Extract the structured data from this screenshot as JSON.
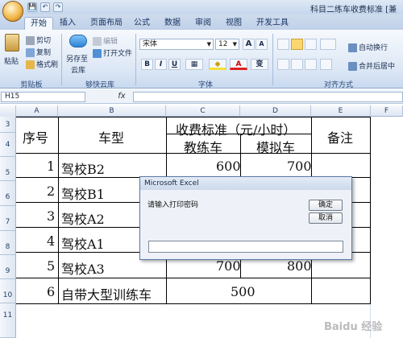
{
  "window": {
    "title": "科目二练车收费标准 [兼"
  },
  "quick_access": {
    "save": "💾",
    "undo": "↶",
    "redo": "↷"
  },
  "tabs": [
    "开始",
    "插入",
    "页面布局",
    "公式",
    "数据",
    "审阅",
    "视图",
    "开发工具"
  ],
  "ribbon": {
    "clipboard": {
      "paste": "粘贴",
      "cut": "剪切",
      "copy": "复制",
      "format_painter": "格式刷",
      "label": "剪贴板"
    },
    "cloud": {
      "save_to": "另存至",
      "save_to2": "云库",
      "edit": "编辑",
      "open": "打开文件",
      "label": "够快云库"
    },
    "font": {
      "name": "宋体",
      "size": "12",
      "grow": "A",
      "shrink": "A",
      "bold": "B",
      "italic": "I",
      "underline": "U",
      "border": "▦",
      "fill": "◆",
      "color": "A",
      "wen": "变",
      "label": "字体"
    },
    "align": {
      "wrap": "自动换行",
      "merge": "合并后居中",
      "label": "对齐方式"
    }
  },
  "formula_bar": {
    "cell": "H15",
    "fx": "fx",
    "value": ""
  },
  "columns": [
    "A",
    "B",
    "C",
    "D",
    "E",
    "F"
  ],
  "rows": [
    "3",
    "4",
    "5",
    "6",
    "7",
    "8",
    "9",
    "10",
    "11"
  ],
  "table": {
    "h_no": "序号",
    "h_type": "车型",
    "h_fee": "收费标准（元/小时）",
    "h_coach": "教练车",
    "h_sim": "模拟车",
    "h_note": "备注",
    "r1": {
      "no": "1",
      "type": "驾校B2",
      "coach": "600",
      "sim": "700"
    },
    "r2": {
      "no": "2",
      "type": "驾校B1"
    },
    "r3": {
      "no": "3",
      "type": "驾校A2"
    },
    "r4": {
      "no": "4",
      "type": "驾校A1"
    },
    "r5": {
      "no": "5",
      "type": "驾校A3",
      "coach": "700",
      "sim": "800"
    },
    "r6": {
      "no": "6",
      "type": "自带大型训练车",
      "coach": "500"
    }
  },
  "dialog": {
    "title": "Microsoft Excel",
    "prompt": "请输入打印密码",
    "ok": "确定",
    "cancel": "取消",
    "value": ""
  },
  "watermark": "Baidu 经验"
}
